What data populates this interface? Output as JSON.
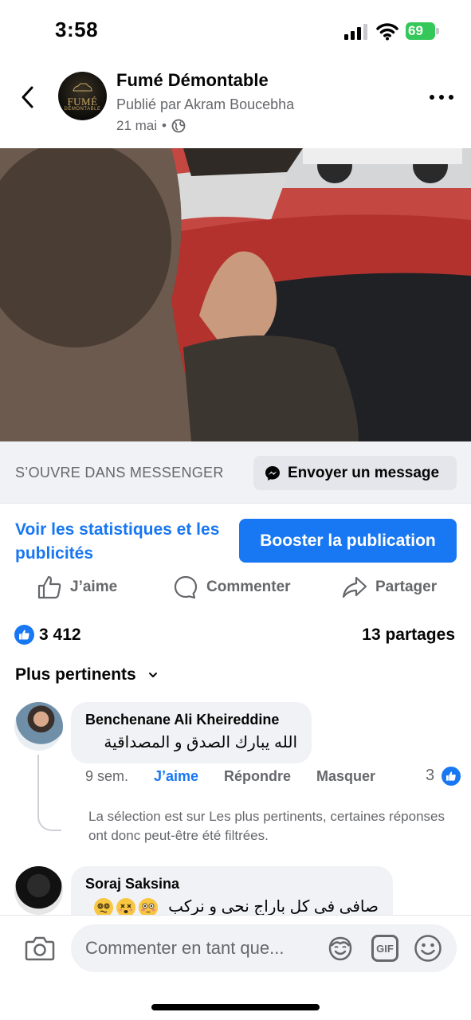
{
  "status_bar": {
    "time": "3:58",
    "battery": "69"
  },
  "post": {
    "page_name": "Fumé Démontable",
    "published_by": "Publié par Akram Boucebha",
    "date": "21 mai",
    "avatar_logo_top": "FUMÉ",
    "avatar_logo_bottom": "DÉMONTABLE"
  },
  "messenger": {
    "label": "S’OUVRE DANS MESSENGER",
    "button": "Envoyer un message"
  },
  "promo": {
    "stats_link": "Voir les statistiques et les publicités",
    "boost_button": "Booster la publication"
  },
  "actions": {
    "like": "J’aime",
    "comment": "Commenter",
    "share": "Partager"
  },
  "counts": {
    "reactions": "3 412",
    "shares": "13 partages"
  },
  "sort": {
    "label": "Plus pertinents"
  },
  "comments": [
    {
      "author": "Benchenane Ali Kheireddine",
      "text": "الله يبارك الصدق و المصداقية",
      "time": "9 sem.",
      "like": "J’aime",
      "reply": "Répondre",
      "hide": "Masquer",
      "like_count": "3"
    },
    {
      "author": "Soraj Saksina",
      "text": "صافى فى كل باراج نحى و نركب"
    }
  ],
  "filter_note": "La sélection est sur Les plus pertinents, certaines réponses ont donc peut-être été filtrées.",
  "composer": {
    "placeholder": "Commenter en tant que...",
    "gif": "GIF"
  },
  "colors": {
    "accent": "#1877f2",
    "muted": "#65676b",
    "bubble": "#f0f2f5"
  }
}
